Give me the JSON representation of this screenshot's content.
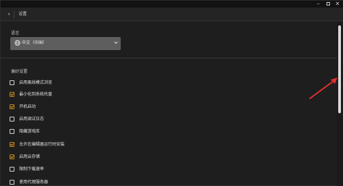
{
  "header": {
    "title": "设置"
  },
  "language": {
    "label": "语言",
    "selected": "中文（中国）"
  },
  "preferences": {
    "label": "偏好设置",
    "options": [
      {
        "label": "启用离线模式浏览",
        "checked": false
      },
      {
        "label": "最小化到系统托盘",
        "checked": true
      },
      {
        "label": "开机启动",
        "checked": true
      },
      {
        "label": "启用调试日志",
        "checked": false
      },
      {
        "label": "隐藏游戏库",
        "checked": false
      },
      {
        "label": "允许在编辑器运行时安装",
        "checked": true
      },
      {
        "label": "启用云存储",
        "checked": true
      },
      {
        "label": "限制下载速率",
        "checked": false
      },
      {
        "label": "使用代理服务器",
        "checked": false
      }
    ]
  },
  "colors": {
    "accent": "#c98a1a",
    "annotation": "#e03030"
  }
}
